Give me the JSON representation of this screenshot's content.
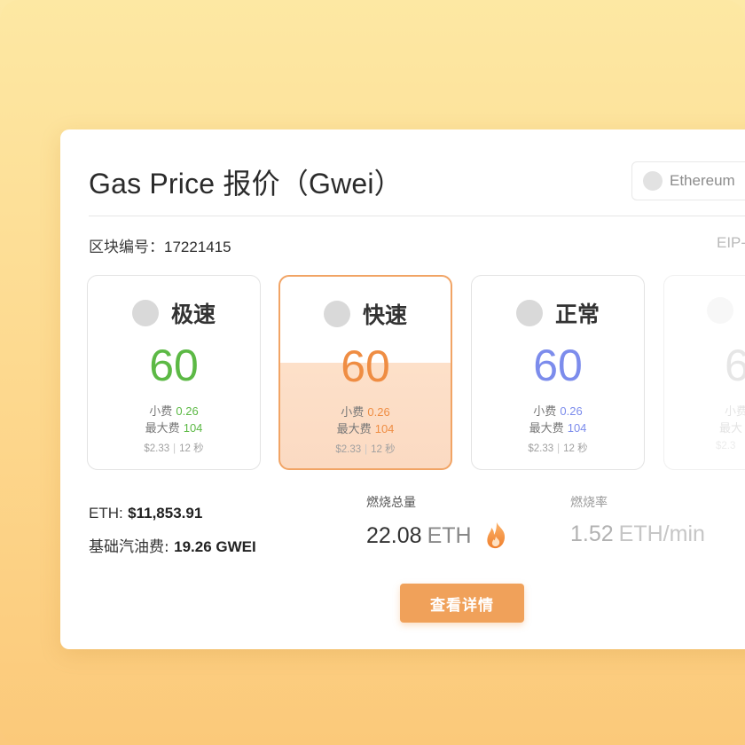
{
  "header": {
    "title": "Gas Price 报价（Gwei）",
    "network": "Ethereum"
  },
  "block": {
    "label": "区块编号：",
    "number": "17221415",
    "eip_label": "EIP-"
  },
  "tiers": [
    {
      "name": "极速",
      "price": "60",
      "tip_label": "小费",
      "tip": "0.26",
      "max_label": "最大费",
      "max": "104",
      "usd": "$2.33",
      "time": "12 秒",
      "color": "#5cb945"
    },
    {
      "name": "快速",
      "price": "60",
      "tip_label": "小费",
      "tip": "0.26",
      "max_label": "最大费",
      "max": "104",
      "usd": "$2.33",
      "time": "12 秒",
      "color": "#ef8d43",
      "selected": true
    },
    {
      "name": "正常",
      "price": "60",
      "tip_label": "小费",
      "tip": "0.26",
      "max_label": "最大费",
      "max": "104",
      "usd": "$2.33",
      "time": "12 秒",
      "color": "#7c8cec"
    },
    {
      "name": "",
      "price": "6",
      "tip_label": "小费",
      "tip": "",
      "max_label": "最大",
      "max": "",
      "usd": "$2.3",
      "time": "",
      "color": "#b5b5b5"
    }
  ],
  "stats": {
    "eth_label": "ETH:",
    "eth_price": "$11,853.91",
    "base_fee_label": "基础汽油费:",
    "base_fee": "19.26 GWEI"
  },
  "burn": {
    "total_label": "燃烧总量",
    "total_value": "22.08",
    "total_unit": "ETH",
    "rate_label": "燃烧率",
    "rate_value": "1.52",
    "rate_unit": "ETH/min",
    "icon": "fire-icon"
  },
  "actions": {
    "details_label": "查看详情"
  }
}
